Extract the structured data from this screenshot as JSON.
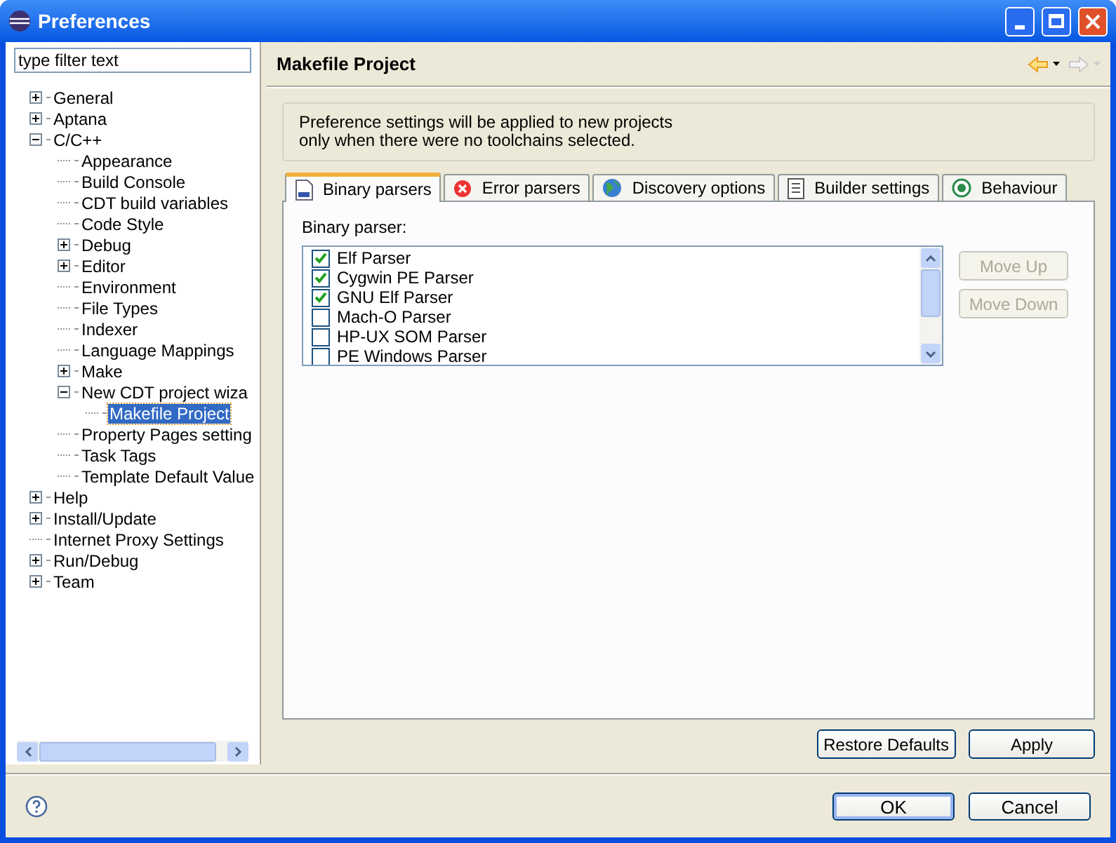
{
  "window": {
    "title": "Preferences"
  },
  "filter": {
    "placeholder": "type filter text"
  },
  "tree": [
    {
      "label": "General",
      "kind": "folder",
      "expanded": false,
      "selected": false
    },
    {
      "label": "Aptana",
      "kind": "folder",
      "expanded": false,
      "selected": false
    },
    {
      "label": "C/C++",
      "kind": "folder",
      "expanded": true,
      "selected": false,
      "children": [
        {
          "label": "Appearance",
          "kind": "leaf",
          "selected": false
        },
        {
          "label": "Build Console",
          "kind": "leaf",
          "selected": false
        },
        {
          "label": "CDT build variables",
          "kind": "leaf",
          "selected": false
        },
        {
          "label": "Code Style",
          "kind": "leaf",
          "selected": false
        },
        {
          "label": "Debug",
          "kind": "folder",
          "expanded": false,
          "selected": false
        },
        {
          "label": "Editor",
          "kind": "folder",
          "expanded": false,
          "selected": false
        },
        {
          "label": "Environment",
          "kind": "leaf",
          "selected": false
        },
        {
          "label": "File Types",
          "kind": "leaf",
          "selected": false
        },
        {
          "label": "Indexer",
          "kind": "leaf",
          "selected": false
        },
        {
          "label": "Language Mappings",
          "kind": "leaf",
          "selected": false
        },
        {
          "label": "Make",
          "kind": "folder",
          "expanded": false,
          "selected": false
        },
        {
          "label": "New CDT project wiza",
          "kind": "folder",
          "expanded": true,
          "selected": false,
          "children": [
            {
              "label": "Makefile Project",
              "kind": "leaf",
              "selected": true
            }
          ]
        },
        {
          "label": "Property Pages setting",
          "kind": "leaf",
          "selected": false
        },
        {
          "label": "Task Tags",
          "kind": "leaf",
          "selected": false
        },
        {
          "label": "Template Default Value",
          "kind": "leaf",
          "selected": false
        }
      ]
    },
    {
      "label": "Help",
      "kind": "folder",
      "expanded": false,
      "selected": false
    },
    {
      "label": "Install/Update",
      "kind": "folder",
      "expanded": false,
      "selected": false
    },
    {
      "label": "Internet Proxy Settings",
      "kind": "leaf",
      "selected": false
    },
    {
      "label": "Run/Debug",
      "kind": "folder",
      "expanded": false,
      "selected": false
    },
    {
      "label": "Team",
      "kind": "folder",
      "expanded": false,
      "selected": false
    }
  ],
  "page": {
    "title": "Makefile Project"
  },
  "nav": [
    {
      "kind": "back",
      "disabled": false
    },
    {
      "kind": "forward",
      "disabled": true
    }
  ],
  "info_lines": [
    "Preference settings will be applied to new projects",
    "only when there were no toolchains selected."
  ],
  "tabs": [
    {
      "label": "Binary parsers",
      "kind": "binary",
      "selected": true
    },
    {
      "label": "Error parsers",
      "kind": "error",
      "selected": false
    },
    {
      "label": "Discovery options",
      "kind": "globe",
      "selected": false
    },
    {
      "label": "Builder settings",
      "kind": "list",
      "selected": false
    },
    {
      "label": "Behaviour",
      "kind": "target",
      "selected": false
    }
  ],
  "binary_parser": {
    "label": "Binary parser:",
    "items": [
      {
        "label": "Elf Parser",
        "checked": true
      },
      {
        "label": "Cygwin PE Parser",
        "checked": true
      },
      {
        "label": "GNU Elf Parser",
        "checked": true
      },
      {
        "label": "Mach-O Parser",
        "checked": false
      },
      {
        "label": "HP-UX SOM Parser",
        "checked": false
      },
      {
        "label": "PE Windows Parser",
        "checked": false
      }
    ]
  },
  "side_buttons": [
    {
      "label": "Move Up",
      "disabled": true
    },
    {
      "label": "Move Down",
      "disabled": true
    }
  ],
  "page_buttons": [
    "Restore Defaults",
    "Apply"
  ],
  "dialog_buttons": [
    {
      "label": "OK",
      "default": true
    },
    {
      "label": "Cancel",
      "default": false
    }
  ]
}
